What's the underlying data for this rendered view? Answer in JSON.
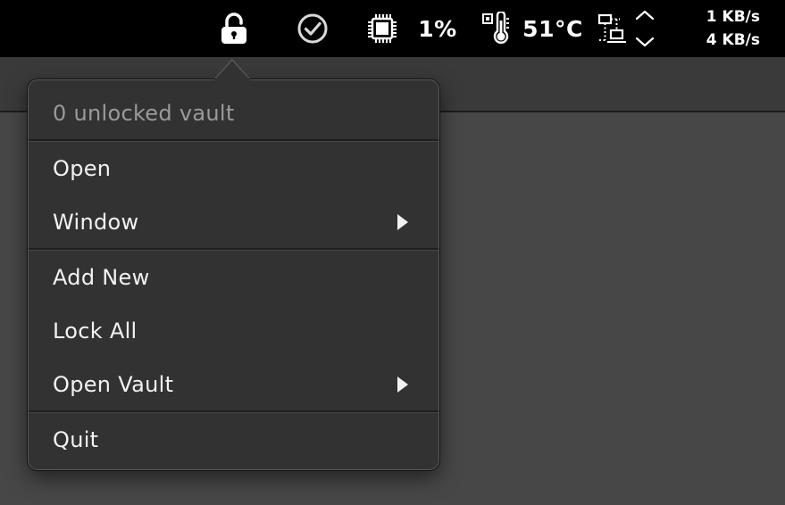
{
  "menubar": {
    "cpu_percent": "1%",
    "temperature": "51°C",
    "net_up": "1 KB/s",
    "net_down": "4 KB/s",
    "icons": {
      "vault": "lock-open-icon",
      "check": "checkmark-circle-icon",
      "cpu": "cpu-chip-icon",
      "thermometer": "thermometer-icon",
      "network": "network-icon",
      "arrows": "up-down-arrows-icon"
    }
  },
  "menu": {
    "header": "0 unlocked vault",
    "items": [
      {
        "label": "Open",
        "submenu": false
      },
      {
        "label": "Window",
        "submenu": true
      },
      {
        "label": "Add New",
        "submenu": false
      },
      {
        "label": "Lock All",
        "submenu": false
      },
      {
        "label": "Open Vault",
        "submenu": true
      },
      {
        "label": "Quit",
        "submenu": false
      }
    ]
  },
  "colors": {
    "menubar_bg": "#000000",
    "menu_bg": "#323232",
    "desktop_bg": "#474747"
  }
}
